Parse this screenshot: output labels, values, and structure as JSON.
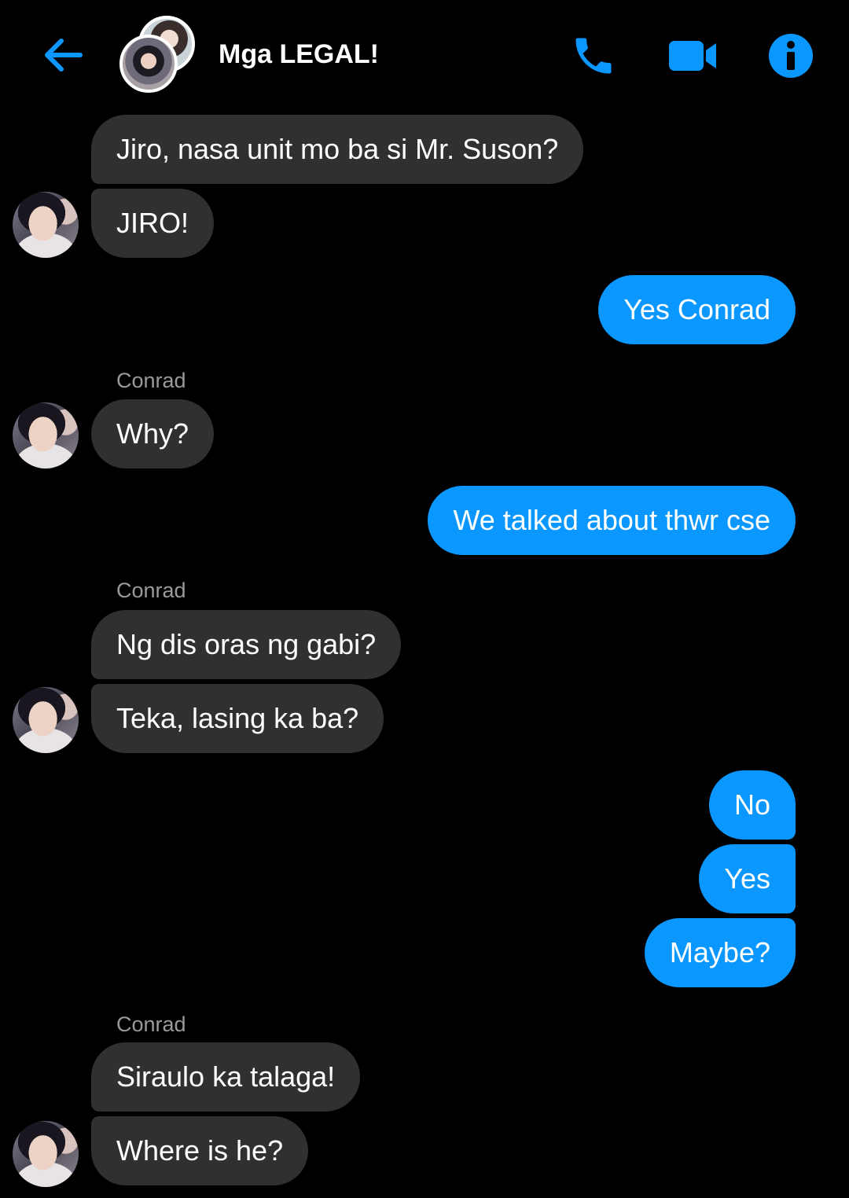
{
  "header": {
    "title": "Mga LEGAL!",
    "back_icon": "arrow-left-icon",
    "call_icon": "phone-icon",
    "video_icon": "video-camera-icon",
    "info_icon": "info-icon",
    "accent_color": "#0a97ff"
  },
  "colors": {
    "background": "#000000",
    "incoming_bubble": "#303030",
    "outgoing_bubble": "#0a97ff",
    "sender_name": "#9a9a9a"
  },
  "messages": [
    {
      "from": "them",
      "text": "Jiro, nasa unit mo ba si Mr. Suson?"
    },
    {
      "from": "them",
      "text": "JIRO!"
    },
    {
      "from": "me",
      "text": "Yes Conrad"
    },
    {
      "from": "them",
      "sender": "Conrad",
      "text": "Why?"
    },
    {
      "from": "me",
      "text": "We talked about thwr cse"
    },
    {
      "from": "them",
      "sender": "Conrad",
      "text": "Ng dis oras ng gabi?"
    },
    {
      "from": "them",
      "text": "Teka, lasing ka ba?"
    },
    {
      "from": "me",
      "text": "No"
    },
    {
      "from": "me",
      "text": "Yes"
    },
    {
      "from": "me",
      "text": "Maybe?"
    },
    {
      "from": "them",
      "sender": "Conrad",
      "text": "Siraulo ka talaga!"
    },
    {
      "from": "them",
      "text": "Where is he?"
    }
  ]
}
